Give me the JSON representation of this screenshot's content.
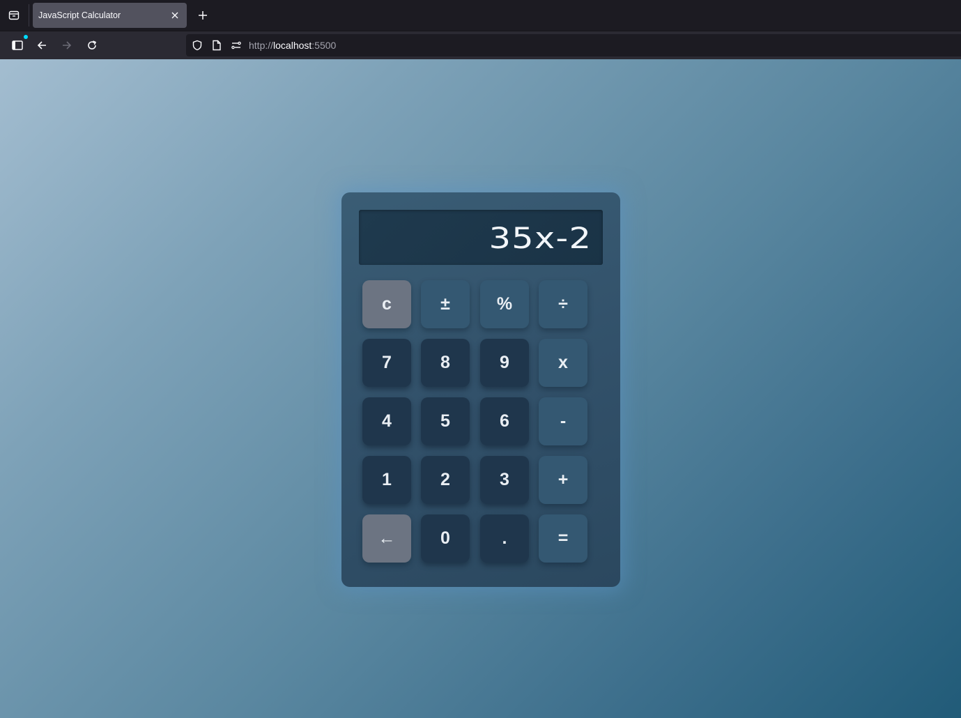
{
  "browser": {
    "tab_title": "JavaScript Calculator",
    "url_scheme": "http://",
    "url_host": "localhost",
    "url_port": ":5500"
  },
  "calculator": {
    "display": "35x-2",
    "keys": [
      {
        "label": "c",
        "kind": "util",
        "name": "clear-key"
      },
      {
        "label": "±",
        "kind": "op",
        "name": "sign-toggle-key"
      },
      {
        "label": "%",
        "kind": "op",
        "name": "percent-key"
      },
      {
        "label": "÷",
        "kind": "op",
        "name": "divide-key"
      },
      {
        "label": "7",
        "kind": "num",
        "name": "digit-7-key"
      },
      {
        "label": "8",
        "kind": "num",
        "name": "digit-8-key"
      },
      {
        "label": "9",
        "kind": "num",
        "name": "digit-9-key"
      },
      {
        "label": "x",
        "kind": "op",
        "name": "multiply-key"
      },
      {
        "label": "4",
        "kind": "num",
        "name": "digit-4-key"
      },
      {
        "label": "5",
        "kind": "num",
        "name": "digit-5-key"
      },
      {
        "label": "6",
        "kind": "num",
        "name": "digit-6-key"
      },
      {
        "label": "-",
        "kind": "op",
        "name": "subtract-key"
      },
      {
        "label": "1",
        "kind": "num",
        "name": "digit-1-key"
      },
      {
        "label": "2",
        "kind": "num",
        "name": "digit-2-key"
      },
      {
        "label": "3",
        "kind": "num",
        "name": "digit-3-key"
      },
      {
        "label": "+",
        "kind": "op",
        "name": "add-key"
      },
      {
        "label": "←",
        "kind": "util",
        "name": "backspace-key"
      },
      {
        "label": "0",
        "kind": "num",
        "name": "digit-0-key"
      },
      {
        "label": ".",
        "kind": "num",
        "name": "decimal-key"
      },
      {
        "label": "=",
        "kind": "op",
        "name": "equals-key"
      }
    ]
  },
  "colors": {
    "number_key": "#1f364c",
    "operator_key": "#345872",
    "utility_key": "#6c7482",
    "calculator_body": "#32516a",
    "display_bg": "#1c3548"
  }
}
